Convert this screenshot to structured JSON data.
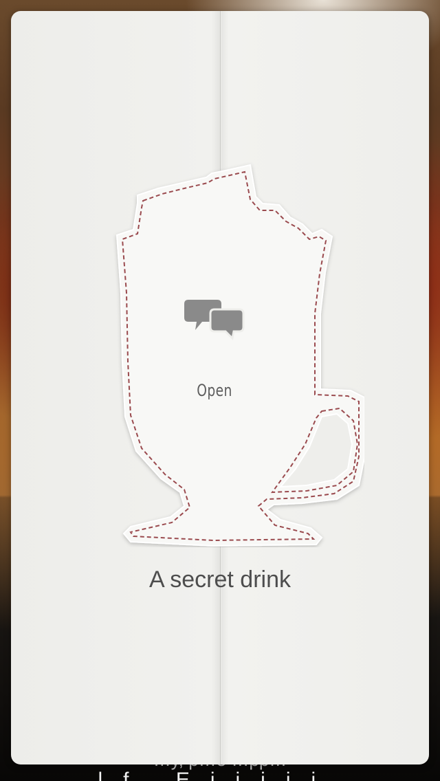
{
  "card": {
    "action_label": "Open",
    "title": "A secret drink",
    "icon": "chat-bubbles-icon",
    "illustration": "glass-mug-icon"
  },
  "background": {
    "partial_text_line1": "…y, p…e …pp…",
    "partial_text_line2": "…l…f… …E…i…i…i…i…i… …"
  },
  "colors": {
    "card_background": "#eeeeeb",
    "stitch": "#9a4a4e",
    "icon": "#8a8a8a",
    "title_text": "#4d4d4d"
  }
}
